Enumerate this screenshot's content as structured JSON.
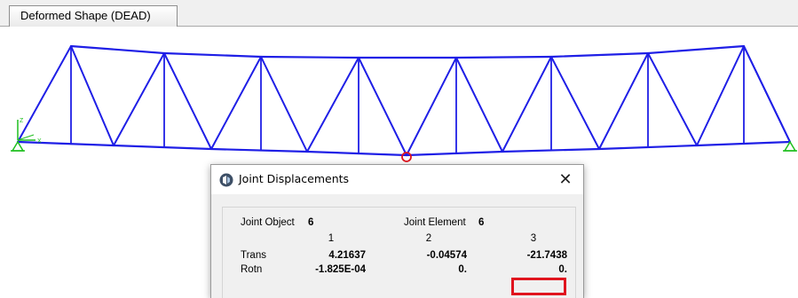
{
  "tab": {
    "label": "Deformed Shape (DEAD)"
  },
  "axes": {
    "z_label": "Z",
    "x_label": "X"
  },
  "dialog": {
    "title": "Joint Displacements",
    "close_glyph": "✕",
    "joint_object_label": "Joint Object",
    "joint_object_value": "6",
    "joint_element_label": "Joint Element",
    "joint_element_value": "6",
    "columns": [
      "1",
      "2",
      "3"
    ],
    "rows": [
      {
        "label": "Trans",
        "values": [
          "4.21637",
          "-0.04574",
          "-21.7438"
        ]
      },
      {
        "label": "Rotn",
        "values": [
          "-1.825E-04",
          "0.",
          "0."
        ]
      }
    ]
  },
  "colors": {
    "truss": "#1f1fe6",
    "highlight": "#e0141e",
    "support": "#1fbf1f"
  }
}
